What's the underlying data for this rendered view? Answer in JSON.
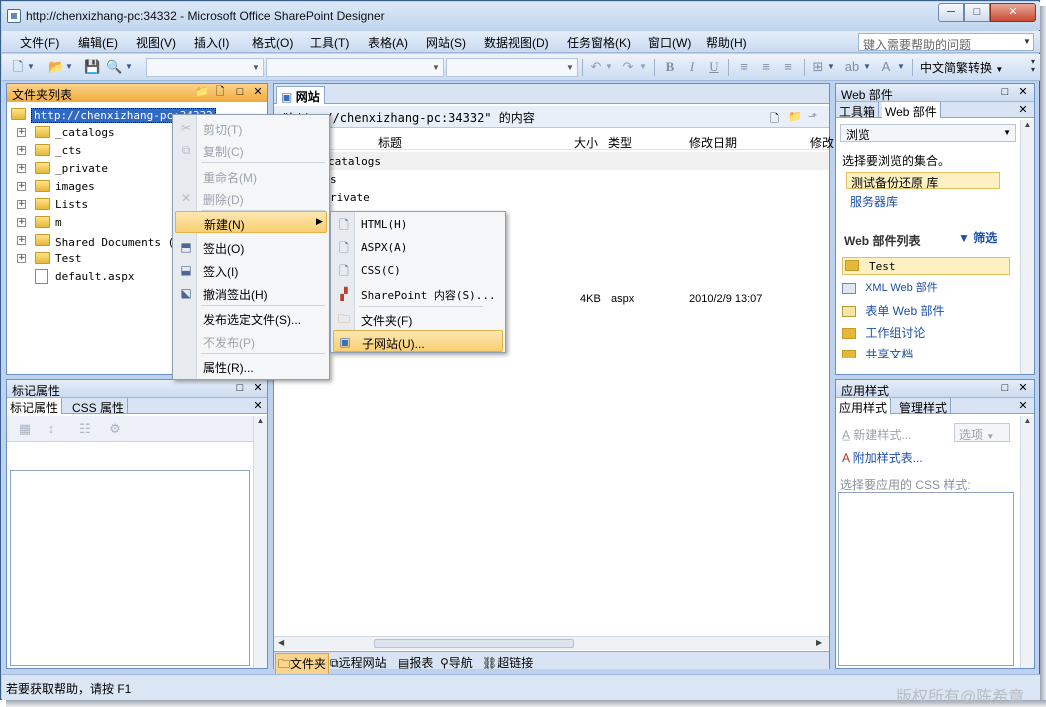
{
  "window": {
    "title": "http://chenxizhang-pc:34332 - Microsoft Office SharePoint Designer",
    "min_glyph": "─",
    "max_glyph": "□",
    "close_glyph": "✕"
  },
  "menubar": {
    "items": [
      "文件(F)",
      "编辑(E)",
      "视图(V)",
      "插入(I)",
      "格式(O)",
      "工具(T)",
      "表格(A)",
      "网站(S)",
      "数据视图(D)",
      "任务窗格(K)",
      "窗口(W)",
      "帮助(H)"
    ],
    "help_placeholder": "键入需要帮助的问题"
  },
  "toolbar": {
    "convert_label": "中文简繁转换"
  },
  "folder_list": {
    "title": "文件夹列表",
    "root": "http://chenxizhang-pc:34332",
    "items": [
      "_catalogs",
      "_cts",
      "_private",
      "images",
      "Lists",
      "m",
      "Shared Documents (共享",
      "Test",
      "default.aspx"
    ]
  },
  "context_menu": {
    "items": [
      "剪切(T)",
      "复制(C)",
      "重命名(M)",
      "删除(D)",
      "新建(N)",
      "签出(O)",
      "签入(I)",
      "撤消签出(H)",
      "发布选定文件(S)...",
      "不发布(P)",
      "属性(R)..."
    ]
  },
  "submenu": {
    "items": [
      "HTML(H)",
      "ASPX(A)",
      "CSS(C)",
      "SharePoint 内容(S)...",
      "文件夹(F)",
      "子网站(U)..."
    ]
  },
  "main": {
    "tab": "网站",
    "path": "\"http://chenxizhang-pc:34332\" 的内容",
    "columns": [
      "标题",
      "大小",
      "类型",
      "修改日期",
      "修改"
    ],
    "rows": [
      {
        "name": "_catalogs"
      },
      {
        "name": "_cts"
      },
      {
        "name": "_private"
      },
      {
        "name": "default.aspx",
        "size": "4KB",
        "type": "aspx",
        "date": "2010/2/9 13:07"
      }
    ],
    "visible_row_fragments": [
      "catalogs",
      "s",
      "rivate"
    ],
    "bottom_tabs": [
      "文件夹",
      "远程网站",
      "报表",
      "导航",
      "超链接"
    ]
  },
  "tag_props": {
    "title": "标记属性",
    "tabs": [
      "标记属性",
      "CSS 属性"
    ]
  },
  "web_parts": {
    "title": "Web 部件",
    "tabs": [
      "工具箱",
      "Web 部件"
    ],
    "dropdown": "浏览",
    "prompt": "选择要浏览的集合。",
    "collections": [
      "测试备份还原 库",
      "服务器库"
    ],
    "list_title": "Web 部件列表",
    "filter": "筛选",
    "list": [
      "Test",
      "XML Web 部件",
      "表单 Web 部件",
      "工作组讨论",
      "共享文档"
    ]
  },
  "app_styles": {
    "title": "应用样式",
    "tabs": [
      "应用样式",
      "管理样式"
    ],
    "new_style": "新建样式...",
    "options": "选项",
    "attach": "附加样式表...",
    "prompt": "选择要应用的 CSS 样式:"
  },
  "status": {
    "text": "若要获取帮助，请按 F1",
    "watermark": "版权所有@陈希章"
  }
}
